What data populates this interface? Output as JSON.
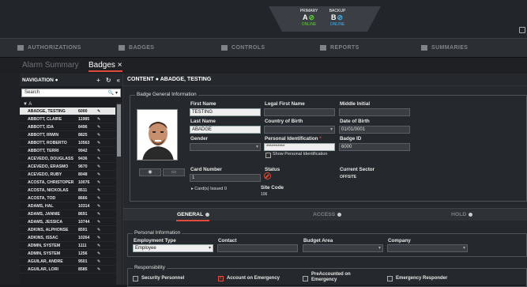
{
  "status": {
    "primary": {
      "title": "PRIMARY",
      "letter": "A",
      "state": "ONLINE"
    },
    "backup": {
      "title": "BACKUP",
      "letter": "B",
      "state": "ONLINE"
    }
  },
  "nav": [
    "AUTHORIZATIONS",
    "BADGES",
    "CONTROLS",
    "REPORTS",
    "SUMMARIES"
  ],
  "tabs": {
    "alarm": "Alarm Summary",
    "badges": "Badges",
    "close": "×"
  },
  "sidebar": {
    "title": "NAVIGATION",
    "search_placeholder": "Search",
    "search_icons": "🔍 ▾",
    "letter": "▼ A",
    "rows": [
      {
        "name": "ABADGE, TESTING",
        "id": "6000"
      },
      {
        "name": "ABBOTT, CLAIRE",
        "id": "11985"
      },
      {
        "name": "ABBOTT, IDA",
        "id": "8496"
      },
      {
        "name": "ABBOTT, IRWIN",
        "id": "8825"
      },
      {
        "name": "ABBOTT, ROBERTO",
        "id": "10563"
      },
      {
        "name": "ABBOTT, TERRI",
        "id": "9942"
      },
      {
        "name": "ACEVEDO, DOUGLASS",
        "id": "9436"
      },
      {
        "name": "ACEVEDO, ERASMO",
        "id": "9670"
      },
      {
        "name": "ACEVEDO, RUBY",
        "id": "8048"
      },
      {
        "name": "ACOSTA, CHRISTOPER",
        "id": "10076"
      },
      {
        "name": "ACOSTA, NICKOLAS",
        "id": "8511"
      },
      {
        "name": "ACOSTA, TOD",
        "id": "8666"
      },
      {
        "name": "ADAMS, HAL",
        "id": "10314"
      },
      {
        "name": "ADAMS, JANNIE",
        "id": "8691"
      },
      {
        "name": "ADAMS, JESSICA",
        "id": "10744"
      },
      {
        "name": "ADKINS, ALPHONSE",
        "id": "8591"
      },
      {
        "name": "ADKINS, ISSAC",
        "id": "10264"
      },
      {
        "name": "ADMIN, SYSTEM",
        "id": "1111"
      },
      {
        "name": "ADMIN, SYSTEM",
        "id": "1256"
      },
      {
        "name": "AGUILAR, ANDRE",
        "id": "9501"
      },
      {
        "name": "AGUILAR, LORI",
        "id": "8585"
      }
    ]
  },
  "content": {
    "header": "CONTENT",
    "record": "ABADGE, TESTING",
    "group_title": "Badge General Information",
    "first_name_label": "First Name",
    "first_name": "TESTING",
    "legal_first_label": "Legal First Name",
    "middle_label": "Middle Initial",
    "last_name_label": "Last Name",
    "last_name": "ABADGE",
    "country_label": "Country of Birth",
    "dob_label": "Date of Birth",
    "dob": "01/01/0001",
    "gender_label": "Gender",
    "pid_label": "Personal Identification",
    "pid_value": "**********",
    "show_pid": "Show Personal Identification",
    "badge_id_label": "Badge ID",
    "badge_id": "6000",
    "card_label": "Card Number",
    "card": "1",
    "cards_issued_label": "Card(s) Issued",
    "cards_issued": "0",
    "status_label": "Status",
    "sector_label": "Current Sector",
    "sector": "OFFSITE",
    "site_code_label": "Site Code",
    "site_code": "106"
  },
  "sections": [
    "GENERAL",
    "ACCESS",
    "HOLD"
  ],
  "personal": {
    "title": "Personal Information",
    "employment_label": "Employment Type",
    "employment": "Employee",
    "contact_label": "Contact",
    "budget_label": "Budget Area",
    "company_label": "Company"
  },
  "responsibility": {
    "title": "Responsibility",
    "items": [
      "Security Personnel",
      "Account on Emergency",
      "PreAccounted on Emergency",
      "Emergency Responder"
    ],
    "checked": [
      false,
      true,
      false,
      false
    ]
  }
}
